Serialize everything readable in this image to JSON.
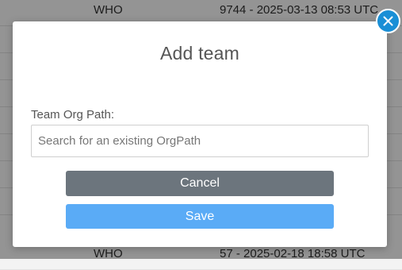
{
  "background_rows": [
    {
      "col1": "WHO",
      "col2": "9744 - 2025-03-13 08:53 UTC"
    },
    {
      "col1": "",
      "col2": ""
    },
    {
      "col1": "",
      "col2": ""
    },
    {
      "col1": "",
      "col2": ""
    },
    {
      "col1": "",
      "col2": ""
    },
    {
      "col1": "",
      "col2": ""
    },
    {
      "col1": "",
      "col2": ""
    },
    {
      "col1": "",
      "col2": ""
    },
    {
      "col1": "WHO",
      "col2": "57 - 2025-02-18 18:58 UTC"
    }
  ],
  "modal": {
    "title": "Add team",
    "field_label": "Team Org Path:",
    "search_placeholder": "Search for an existing OrgPath",
    "search_value": "",
    "cancel_label": "Cancel",
    "save_label": "Save"
  },
  "icons": {
    "close": "close-icon"
  },
  "colors": {
    "cancel_button": "#6c757d",
    "save_button": "#5aabf6",
    "close_button": "#1a8fd6"
  }
}
